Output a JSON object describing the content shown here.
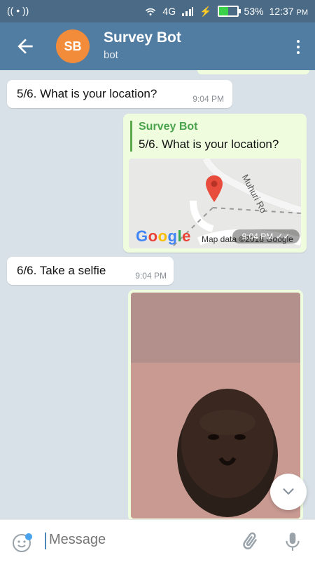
{
  "status": {
    "time": "12:37",
    "ampm": "PM",
    "battery_percent": "53%",
    "battery_level": 0.53,
    "network_type": "4G",
    "hotspot_icon": "wireless-broadcast-icon",
    "colors": {
      "bar": "#4a6a85",
      "battery_fill": "#3ad14a"
    }
  },
  "header": {
    "avatar_initials": "SB",
    "title": "Survey Bot",
    "subtitle": "bot",
    "avatar_color": "#f28c3a",
    "toolbar_color": "#527da3"
  },
  "messages": {
    "m1": {
      "text": "5/6. What is your location?",
      "time": "9:04 PM"
    },
    "m2": {
      "reply_sender": "Survey Bot",
      "reply_text": "5/6. What is your location?",
      "map_label": "Muhuri Ro",
      "map_data": "Map data ©2018 Google",
      "google": "Google",
      "time": "9:04 PM",
      "status_icon": "double-check-icon"
    },
    "m3": {
      "text": "6/6. Take a selfie",
      "time": "9:04 PM"
    }
  },
  "input": {
    "placeholder": "Message"
  }
}
